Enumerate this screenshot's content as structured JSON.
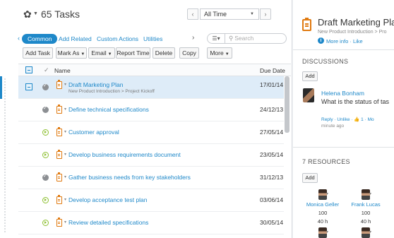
{
  "header": {
    "task_count": "65 Tasks",
    "period": "All Time"
  },
  "tabs": {
    "active": "Common",
    "items": [
      "Add Related",
      "Custom Actions",
      "Utilities"
    ],
    "search_placeholder": "Search"
  },
  "toolbar": {
    "add_task": "Add Task",
    "mark_as": "Mark As",
    "email": "Email",
    "report_time": "Report Time",
    "delete": "Delete",
    "copy": "Copy",
    "more": "More"
  },
  "table": {
    "columns": {
      "name": "Name",
      "due": "Due Date"
    },
    "rows": [
      {
        "name": "Draft Marketing Plan",
        "path": "New Product Introduction > Project Kickoff",
        "due": "17/01/14",
        "status": "completed",
        "selected": true
      },
      {
        "name": "Define technical specifications",
        "path": "",
        "due": "24/12/13",
        "status": "completed",
        "selected": false
      },
      {
        "name": "Customer approval",
        "path": "",
        "due": "27/05/14",
        "status": "in-progress",
        "selected": false
      },
      {
        "name": "Develop business requirements document",
        "path": "",
        "due": "23/05/14",
        "status": "in-progress",
        "selected": false
      },
      {
        "name": "Gather business needs from key stakeholders",
        "path": "",
        "due": "31/12/13",
        "status": "completed",
        "selected": false
      },
      {
        "name": "Develop acceptance test plan",
        "path": "",
        "due": "03/06/14",
        "status": "in-progress",
        "selected": false
      },
      {
        "name": "Review detailed specifications",
        "path": "",
        "due": "30/05/14",
        "status": "in-progress",
        "selected": false
      }
    ]
  },
  "detail": {
    "title": "Draft Marketing Pla",
    "breadcrumb": "New Product Introduction > Pro",
    "more_info": "More info",
    "like": "Like",
    "discussions_heading": "DISCUSSIONS",
    "add_label": "Add",
    "comment": {
      "author": "Helena Bonham",
      "text": "What is the status of tas",
      "reply": "Reply",
      "unlike": "Unlike",
      "likes": "1",
      "more": "Mo",
      "time": "minute ago"
    },
    "resources_heading": "7 RESOURCES",
    "resources": [
      {
        "name": "Monica Geller",
        "value": "100",
        "hours": "40 h"
      },
      {
        "name": "Frank Lucas",
        "value": "100",
        "hours": "40 h"
      }
    ]
  },
  "colors": {
    "accent": "#1e88c9",
    "task_icon": "#e07a10",
    "in_progress": "#8cbf2f",
    "completed": "#8c8f93"
  }
}
